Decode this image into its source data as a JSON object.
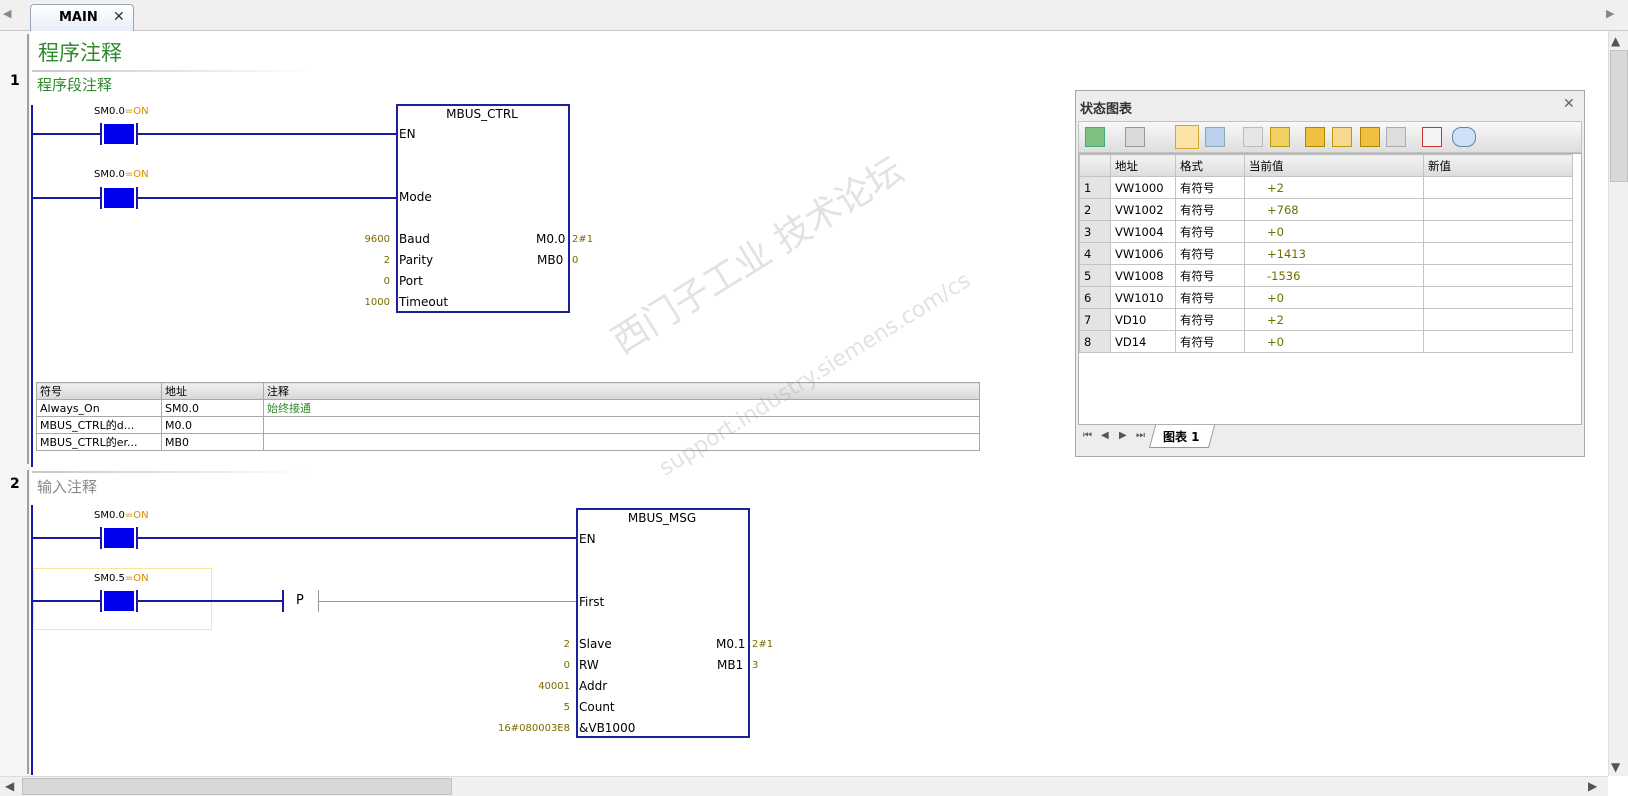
{
  "tab": {
    "label": "MAIN",
    "close": "✕"
  },
  "program_comment": "程序注释",
  "networks": [
    {
      "number": "1",
      "comment": "程序段注释",
      "contacts": [
        {
          "address": "SM0.0",
          "state": "=ON"
        },
        {
          "address": "SM0.0",
          "state": "=ON"
        }
      ],
      "block": {
        "name": "MBUS_CTRL",
        "inputs": [
          "EN",
          "Mode",
          "Baud",
          "Parity",
          "Port",
          "Timeout"
        ],
        "input_values": [
          "",
          "",
          "9600",
          "2",
          "0",
          "1000"
        ],
        "outputs": [
          "M0.0",
          "MB0"
        ],
        "output_values": [
          "2#1",
          "0"
        ]
      },
      "symbol_table": {
        "headers": [
          "符号",
          "地址",
          "注释"
        ],
        "rows": [
          [
            "Always_On",
            "SM0.0",
            "始终接通"
          ],
          [
            "MBUS_CTRL的d...",
            "M0.0",
            ""
          ],
          [
            "MBUS_CTRL的er...",
            "MB0",
            ""
          ]
        ]
      }
    },
    {
      "number": "2",
      "comment": "输入注释",
      "contacts": [
        {
          "address": "SM0.0",
          "state": "=ON"
        },
        {
          "address": "SM0.5",
          "state": "=ON"
        }
      ],
      "edge_label": "P",
      "block": {
        "name": "MBUS_MSG",
        "inputs": [
          "EN",
          "First",
          "Slave",
          "RW",
          "Addr",
          "Count",
          "&VB1000"
        ],
        "input_values": [
          "",
          "",
          "2",
          "0",
          "40001",
          "5",
          "16#080003E8"
        ],
        "outputs": [
          "M0.1",
          "MB1"
        ],
        "output_values": [
          "2#1",
          "3"
        ]
      }
    }
  ],
  "status_chart": {
    "title": "状态图表",
    "close": "✕",
    "headers": [
      "",
      "地址",
      "格式",
      "当前值",
      "新值"
    ],
    "rows": [
      [
        "1",
        "VW1000",
        "有符号",
        "+2",
        ""
      ],
      [
        "2",
        "VW1002",
        "有符号",
        "+768",
        ""
      ],
      [
        "3",
        "VW1004",
        "有符号",
        "+0",
        ""
      ],
      [
        "4",
        "VW1006",
        "有符号",
        "+1413",
        ""
      ],
      [
        "5",
        "VW1008",
        "有符号",
        "-1536",
        ""
      ],
      [
        "6",
        "VW1010",
        "有符号",
        "+0",
        ""
      ],
      [
        "7",
        "VD10",
        "有符号",
        "+2",
        ""
      ],
      [
        "8",
        "VD14",
        "有符号",
        "+0",
        ""
      ]
    ],
    "tab_label": "图表 1",
    "nav": [
      "⏮",
      "◀",
      "▶",
      "⏭"
    ]
  },
  "watermark": {
    "line1": "西门子工业  技术论坛",
    "line2": "support.industry.siemens.com/cs"
  },
  "icons": [
    "tab-left-arrow-icon",
    "tab-right-arrow-icon",
    "scroll-left-icon",
    "scroll-right-icon",
    "scroll-up-icon",
    "scroll-down-icon"
  ]
}
